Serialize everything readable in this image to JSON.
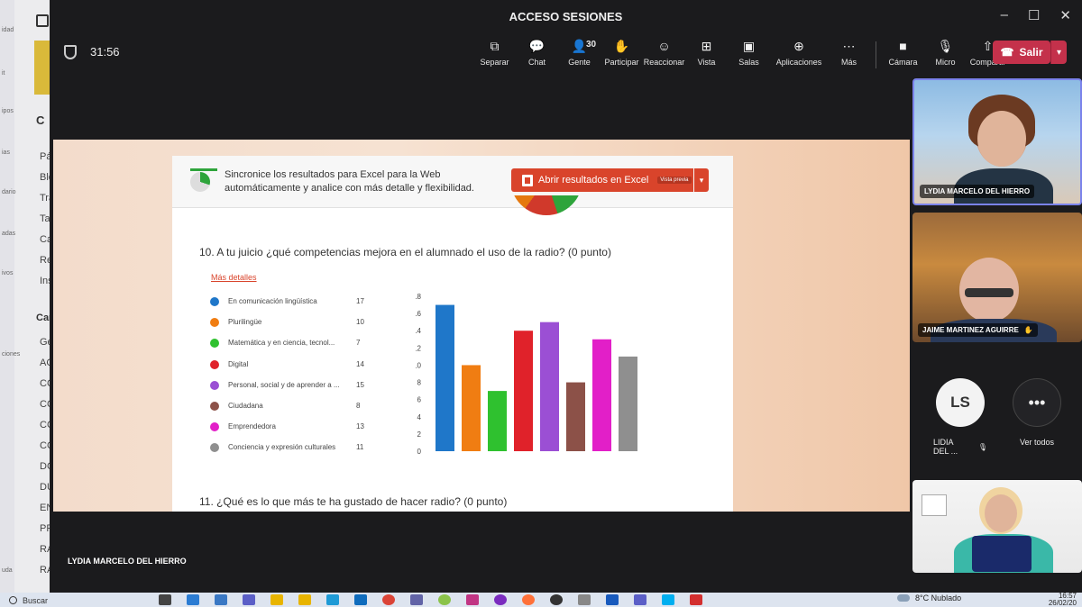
{
  "left_sidebar": {
    "labels": [
      "idad",
      "it",
      "ipos",
      "ias",
      "dario",
      "adas",
      "ivos",
      "ciones",
      "uda"
    ],
    "heading": "C",
    "items": [
      "Pá",
      "Blo",
      "Tra",
      "Tar",
      "Ca",
      "Re",
      "Ins"
    ],
    "section": "Can",
    "channels": [
      "Ge",
      "AC",
      "CC",
      "CC",
      "CC",
      "CC",
      "DC",
      "DU",
      "EN",
      "PR",
      "RA",
      "RA"
    ]
  },
  "window": {
    "title": "ACCESO SESIONES",
    "controls": [
      "–",
      "☐",
      "✕"
    ]
  },
  "meeting": {
    "timer": "31:56",
    "toolbar": [
      {
        "icon": "pop-out-icon",
        "glyph": "⧉",
        "label": "Separar"
      },
      {
        "icon": "chat-icon",
        "glyph": "💬",
        "label": "Chat"
      },
      {
        "icon": "people-icon",
        "glyph": "👤",
        "label": "Gente",
        "count": "30"
      },
      {
        "icon": "raise-hand-icon",
        "glyph": "✋",
        "label": "Participar"
      },
      {
        "icon": "react-icon",
        "glyph": "☺",
        "label": "Reaccionar"
      },
      {
        "icon": "view-icon",
        "glyph": "⊞",
        "label": "Vista"
      },
      {
        "icon": "rooms-icon",
        "glyph": "▣",
        "label": "Salas"
      },
      {
        "icon": "apps-icon",
        "glyph": "⊕",
        "label": "Aplicaciones"
      },
      {
        "icon": "more-icon",
        "glyph": "⋯",
        "label": "Más"
      }
    ],
    "devices": [
      {
        "icon": "camera-icon",
        "glyph": "■",
        "label": "Cámara"
      },
      {
        "icon": "mic-off-icon",
        "glyph": "🎙",
        "label": "Micro"
      },
      {
        "icon": "share-icon",
        "glyph": "⇧",
        "label": "Compartir"
      }
    ],
    "leave_label": "Salir"
  },
  "shared_form": {
    "sync_text": "Sincronice los resultados para Excel para la Web automáticamente y analice con más detalle y flexibilidad.",
    "excel_button": "Abrir resultados en Excel",
    "preview_badge": "Vista previa",
    "question10": "10.  A tu juicio ¿qué competencias mejora en el alumnado el uso de la radio? (0 punto)",
    "more_details": "Más detalles",
    "question11": "11.  ¿Qué es lo que más te ha gustado de hacer radio? (0 punto)"
  },
  "chart_data": {
    "type": "bar",
    "categories": [
      "En comunicación lingüística",
      "Plurilingüe",
      "Matemática y en ciencia, tecnol...",
      "Digital",
      "Personal, social y de aprender a ...",
      "Ciudadana",
      "Emprendedora",
      "Conciencia y expresión culturales"
    ],
    "values": [
      17,
      10,
      7,
      14,
      15,
      8,
      13,
      11
    ],
    "colors": [
      "#1f77c9",
      "#f07d12",
      "#2fc12f",
      "#e0222a",
      "#9b4fd4",
      "#8c5148",
      "#e21fc8",
      "#8f8f8f"
    ],
    "yticks": [
      "0",
      "2",
      "4",
      "6",
      "8",
      "10",
      "12",
      "14",
      "16",
      "18"
    ],
    "ylim": [
      0,
      18
    ],
    "legend": "left"
  },
  "presenter": {
    "name": "LYDIA MARCELO DEL HIERRO"
  },
  "participants": {
    "video1_name": "LYDIA MARCELO DEL HIERRO",
    "video2_name": "JAIME MARTINEZ AGUIRRE",
    "avatar_initials": "LS",
    "avatar_name": "LIDIA DEL ...",
    "see_all": "Ver todos",
    "more_glyph": "•••"
  },
  "taskbar": {
    "search": "Buscar",
    "weather": "8°C  Nublado",
    "time": "16:57",
    "date": "26/02/20"
  }
}
